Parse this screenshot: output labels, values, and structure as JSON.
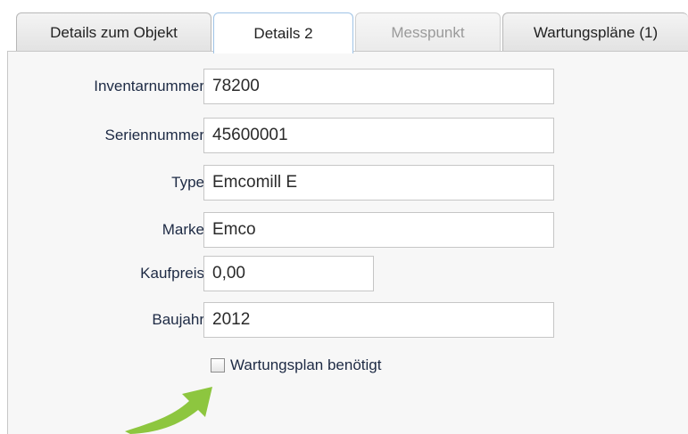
{
  "tabs": [
    {
      "label": "Details zum Objekt",
      "state": "normal"
    },
    {
      "label": "Details 2",
      "state": "active"
    },
    {
      "label": "Messpunkt",
      "state": "disabled"
    },
    {
      "label": "Wartungspläne (1)",
      "state": "normal"
    }
  ],
  "form": {
    "inventarnummer": {
      "label": "Inventarnummer",
      "value": "78200"
    },
    "seriennummer": {
      "label": "Seriennummer",
      "value": "45600001"
    },
    "type": {
      "label": "Type",
      "value": "Emcomill E"
    },
    "marke": {
      "label": "Marke",
      "value": "Emco"
    },
    "kaufpreis": {
      "label": "Kaufpreis",
      "value": "0,00"
    },
    "baujahr": {
      "label": "Baujahr",
      "value": "2012"
    },
    "wartungsplan": {
      "label": "Wartungsplan benötigt",
      "checked": false
    }
  },
  "colors": {
    "accent_arrow": "#8dc63f",
    "active_tab_border": "#9fc3e6",
    "label_text": "#1d2a44"
  },
  "icons": {
    "arrow": "curved-arrow-icon"
  }
}
